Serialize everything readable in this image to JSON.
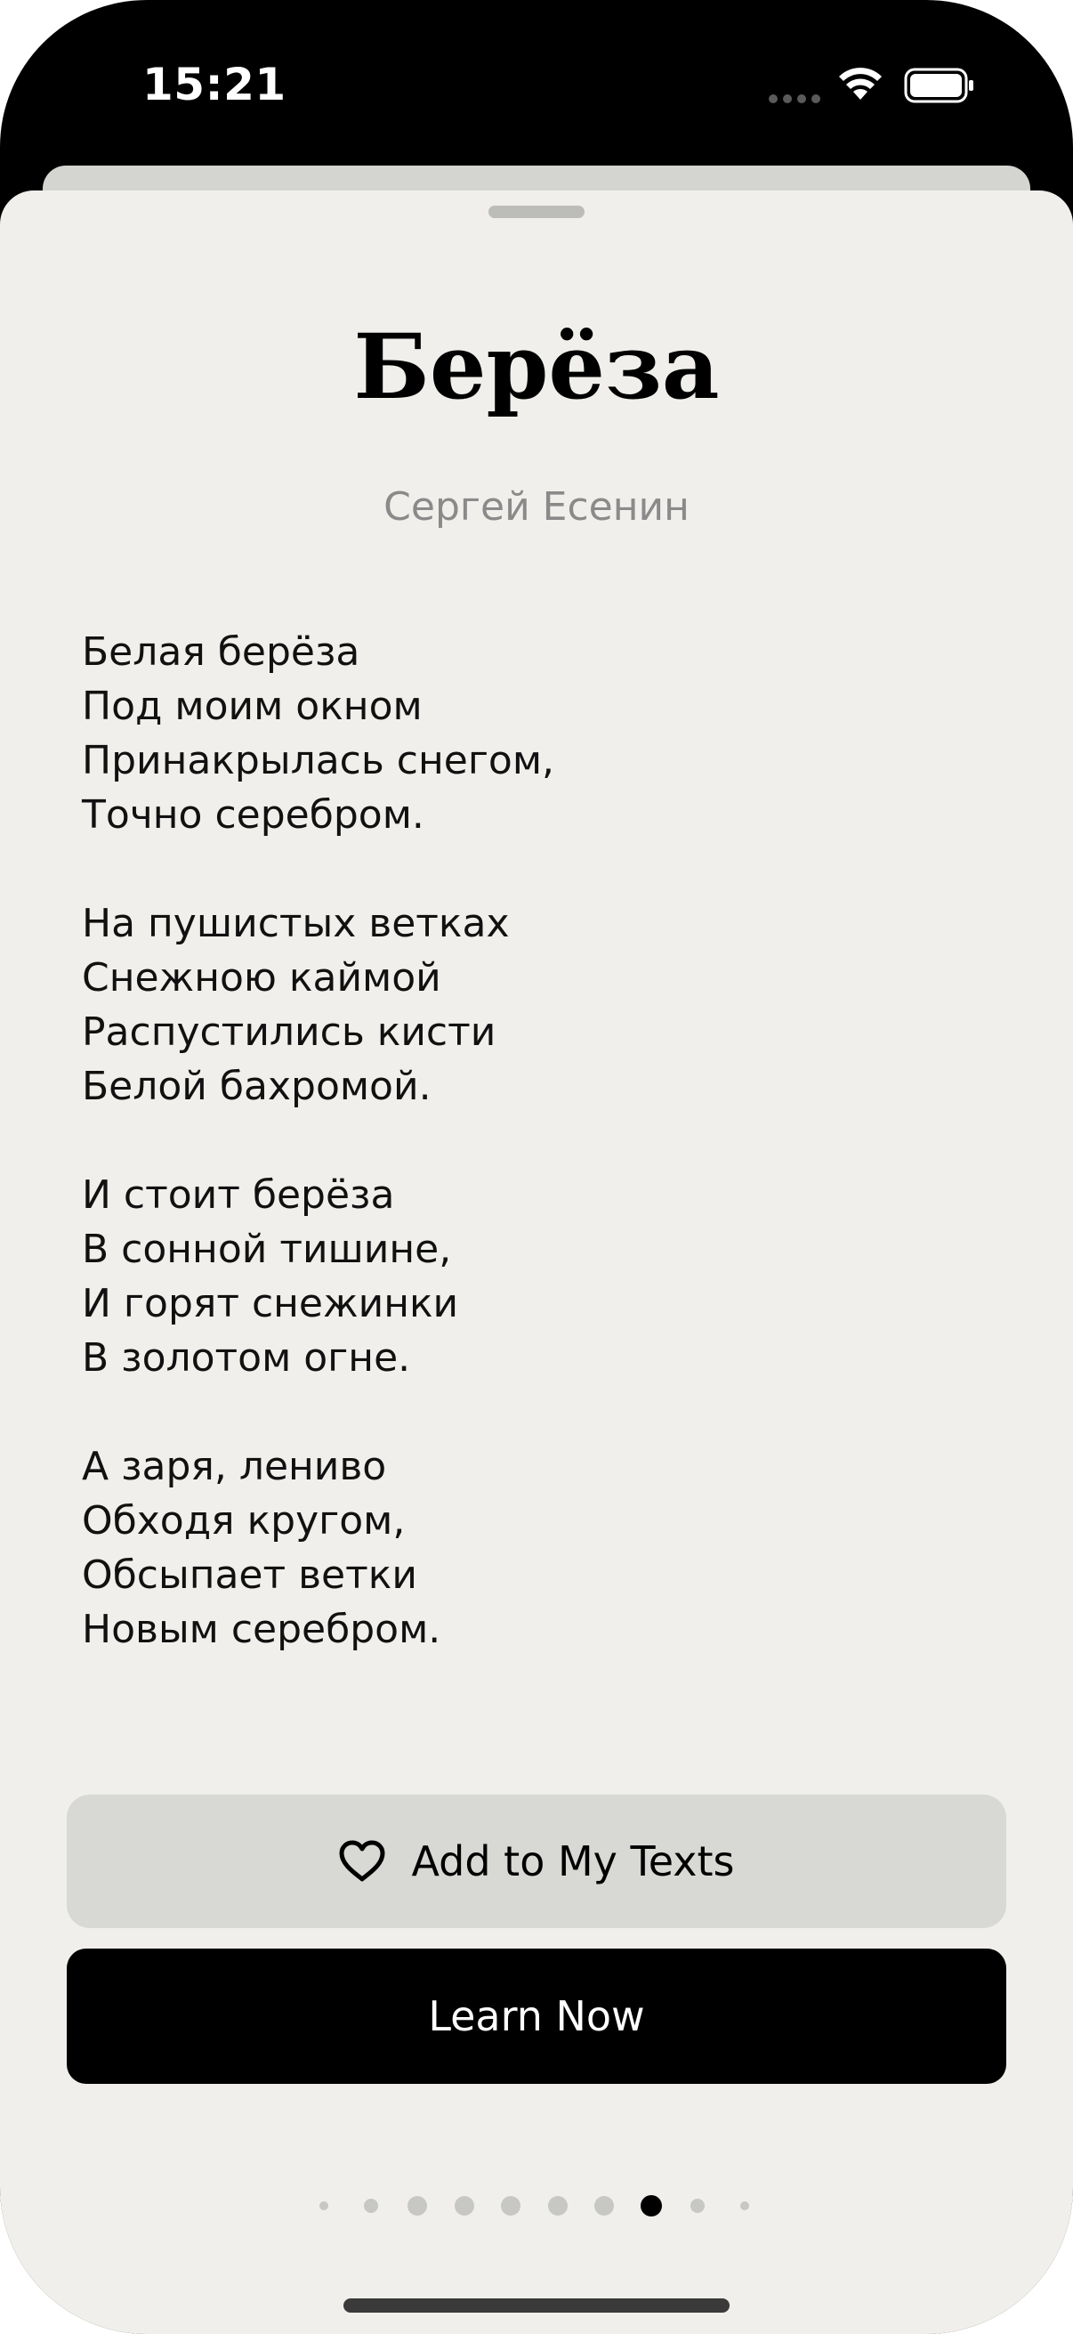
{
  "status_bar": {
    "time": "15:21",
    "icons": [
      "cellular-dots-icon",
      "wifi-icon",
      "battery-icon"
    ]
  },
  "poem": {
    "title": "Берёза",
    "author": "Сергей Есенин",
    "stanzas": [
      [
        "Белая берёза",
        "Под моим окном",
        "Принакрылась снегом,",
        "Точно серебром."
      ],
      [
        "На пушистых ветках",
        "Снежною каймой",
        "Распустились кисти",
        "Белой бахромой."
      ],
      [
        "И стоит берёза",
        "В сонной тишине,",
        "И горят снежинки",
        "В золотом огне."
      ],
      [
        "А заря, лениво",
        "Обходя кругом,",
        "Обсыпает ветки",
        "Новым серебром."
      ]
    ]
  },
  "actions": {
    "add_label": "Add to My Texts",
    "add_icon": "heart-outline-icon",
    "learn_label": "Learn Now"
  },
  "pager": {
    "total": 10,
    "active_index": 7
  },
  "colors": {
    "sheet_background": "#f0efeb",
    "secondary_button": "#d8d8d4",
    "primary_button": "#000000",
    "author_text": "#8a8a8a"
  }
}
